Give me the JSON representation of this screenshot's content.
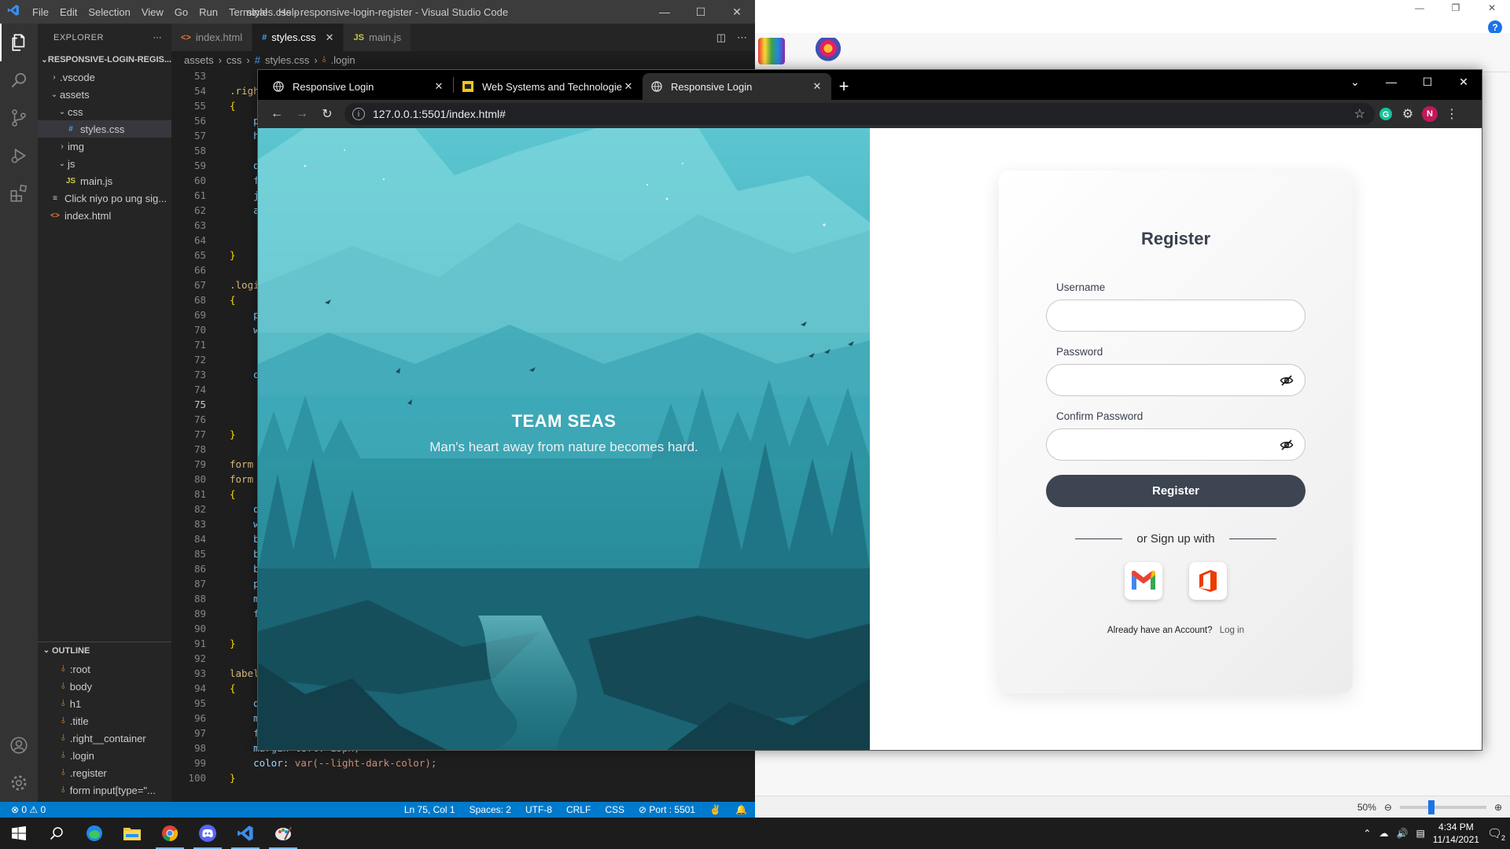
{
  "vscode": {
    "window_title": "styles.css - responsive-login-register - Visual Studio Code",
    "menu": [
      "File",
      "Edit",
      "Selection",
      "View",
      "Go",
      "Run",
      "Terminal",
      "Help"
    ],
    "explorer_title": "EXPLORER",
    "project_name": "RESPONSIVE-LOGIN-REGIS...",
    "tree": [
      {
        "label": ".vscode",
        "kind": "folder-closed",
        "depth": 1
      },
      {
        "label": "assets",
        "kind": "folder-open",
        "depth": 1
      },
      {
        "label": "css",
        "kind": "folder-open",
        "depth": 2
      },
      {
        "label": "styles.css",
        "kind": "css-file",
        "depth": 3,
        "selected": true
      },
      {
        "label": "img",
        "kind": "folder-closed",
        "depth": 2
      },
      {
        "label": "js",
        "kind": "folder-open",
        "depth": 2
      },
      {
        "label": "main.js",
        "kind": "js-file",
        "depth": 3
      },
      {
        "label": "Click niyo po ung sig...",
        "kind": "text-file",
        "depth": 1
      },
      {
        "label": "index.html",
        "kind": "html-file",
        "depth": 1
      }
    ],
    "outline_title": "OUTLINE",
    "outline": [
      ":root",
      "body",
      "h1",
      ".title",
      ".right__container",
      ".login",
      ".register",
      "form input[type=\"..."
    ],
    "tabs": [
      {
        "label": "index.html",
        "icon": "html-icon",
        "active": false
      },
      {
        "label": "styles.css",
        "icon": "css-icon",
        "active": true
      },
      {
        "label": "main.js",
        "icon": "js-icon",
        "active": false
      }
    ],
    "breadcrumb": [
      "assets",
      "css",
      "styles.css",
      ".login"
    ],
    "code_start_line": 53,
    "current_line": 75,
    "code_lines": [
      "",
      ".righ",
      "{",
      "    pos",
      "    hei",
      "",
      "    dis",
      "    fle",
      "    jus",
      "    ali",
      "",
      "",
      "}",
      "",
      ".logi",
      "{",
      "    pos",
      "    wid",
      "",
      "",
      "    ove",
      "",
      "",
      "",
      "}",
      "",
      "form ",
      "form ",
      "{",
      "    d",
      "    w",
      "    b",
      "    b",
      "    b",
      "    p",
      "    m",
      "    f",
      "",
      "}",
      "",
      "label",
      "{",
      "    d",
      "    m",
      "    f",
      "    margin-left: 13px;",
      "    color: var(--light-dark-color);",
      "}"
    ],
    "status": {
      "problems": "⊗ 0 ⚠ 0",
      "position": "Ln 75, Col 1",
      "spaces": "Spaces: 2",
      "encoding": "UTF-8",
      "eol": "CRLF",
      "language": "CSS",
      "port": "⊘ Port : 5501"
    }
  },
  "background_app": {
    "zoom": "50%",
    "zoom_level": 0.5,
    "help": "?"
  },
  "chrome": {
    "tabs": [
      {
        "title": "Responsive Login",
        "active": false
      },
      {
        "title": "Web Systems and Technologies -",
        "active": false
      },
      {
        "title": "Responsive Login",
        "active": true
      }
    ],
    "url": "127.0.0.1:5501/index.html#",
    "profile_initial": "N"
  },
  "page": {
    "hero_title": "TEAM SEAS",
    "hero_subtitle": "Man's heart away from nature becomes hard.",
    "register_title": "Register",
    "username_label": "Username",
    "password_label": "Password",
    "confirm_label": "Confirm Password",
    "register_button": "Register",
    "divider_text": "or Sign up with",
    "already_text": "Already have an Account?",
    "login_link": "Log in",
    "colors": {
      "button": "#3d4452",
      "teal": "#2aa3b0",
      "card": "#f4f4f4"
    }
  },
  "taskbar": {
    "time": "4:34 PM",
    "date": "11/14/2021",
    "notifications": "2",
    "apps": [
      "windows-start",
      "search",
      "edge",
      "file-explorer",
      "chrome",
      "discord",
      "vscode",
      "other-app"
    ]
  }
}
